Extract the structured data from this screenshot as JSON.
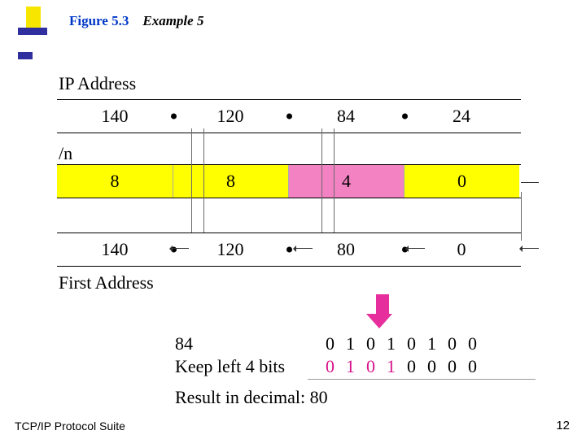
{
  "figure": {
    "label": "Figure 5.3",
    "name": "Example 5"
  },
  "labels": {
    "ip": "IP Address",
    "n": "/n",
    "first": "First Address",
    "binlabel1": "84",
    "binlabel2": "Keep left 4 bits",
    "result": "Result in decimal: 80"
  },
  "ip": {
    "a": "140",
    "b": "120",
    "c": "84",
    "d": "24"
  },
  "mask": {
    "a": "8",
    "b": "8",
    "c": "4",
    "d": "0"
  },
  "first": {
    "a": "140",
    "b": "120",
    "c": "80",
    "d": "0"
  },
  "bits": {
    "row1": [
      "0",
      "1",
      "0",
      "1",
      "0",
      "1",
      "0",
      "0"
    ],
    "row2": [
      "0",
      "1",
      "0",
      "1",
      "0",
      "0",
      "0",
      "0"
    ]
  },
  "footer": {
    "text": "TCP/IP Protocol Suite",
    "page": "12"
  }
}
